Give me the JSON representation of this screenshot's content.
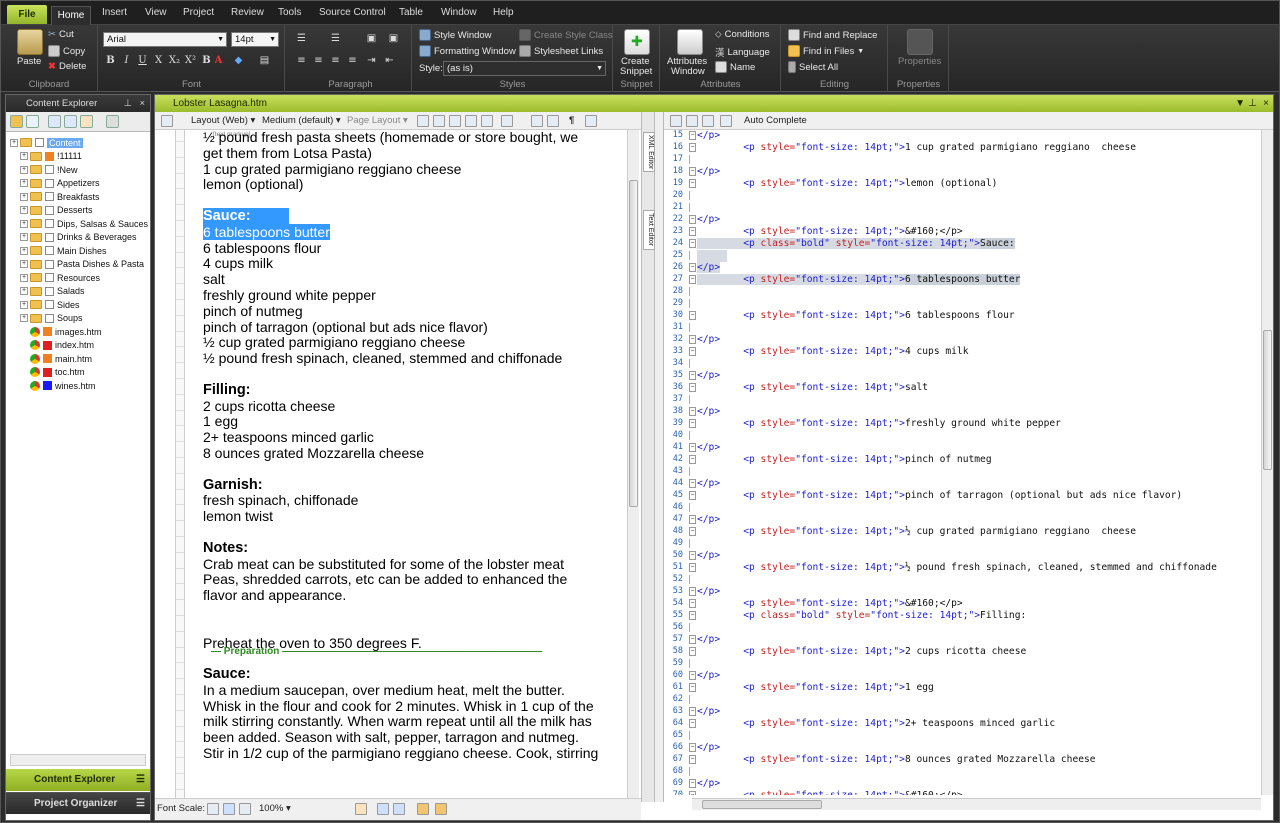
{
  "ribbon": {
    "tabs": [
      "File",
      "Home",
      "Insert",
      "View",
      "Project",
      "Review",
      "Tools",
      "Source Control",
      "Table",
      "Window",
      "Help"
    ],
    "clipboard": {
      "paste": "Paste",
      "cut": "Cut",
      "copy": "Copy",
      "delete": "Delete",
      "label": "Clipboard"
    },
    "font": {
      "family": "Arial",
      "size": "14pt",
      "label": "Font"
    },
    "paragraph": {
      "label": "Paragraph"
    },
    "styles": {
      "style_window": "Style Window",
      "formatting_window": "Formatting Window",
      "create_style_class": "Create Style Class",
      "stylesheet_links": "Stylesheet Links",
      "style_label": "Style:",
      "style_value": "(as is)",
      "label": "Styles"
    },
    "snippet": {
      "create": "Create",
      "snippet": "Snippet",
      "label": "Snippet"
    },
    "attributes": {
      "attributes": "Attributes",
      "window": "Window",
      "conditions": "Conditions",
      "language": "Language",
      "name": "Name",
      "label": "Attributes"
    },
    "editing": {
      "find_replace": "Find and Replace",
      "find_in_files": "Find in Files",
      "select_all": "Select All",
      "label": "Editing"
    },
    "properties": {
      "btn": "Properties",
      "label": "Properties"
    }
  },
  "left_pane": {
    "title": "Content Explorer",
    "tree": [
      {
        "name": "Content",
        "type": "root"
      },
      {
        "name": "!11111",
        "type": "folder",
        "color": "#f08020"
      },
      {
        "name": "!New",
        "type": "folder"
      },
      {
        "name": "Appetizers",
        "type": "folder"
      },
      {
        "name": "Breakfasts",
        "type": "folder"
      },
      {
        "name": "Desserts",
        "type": "folder"
      },
      {
        "name": "Dips, Salsas & Sauces",
        "type": "folder"
      },
      {
        "name": "Drinks & Beverages",
        "type": "folder"
      },
      {
        "name": "Main Dishes",
        "type": "folder"
      },
      {
        "name": "Pasta Dishes & Pasta",
        "type": "folder"
      },
      {
        "name": "Resources",
        "type": "folder"
      },
      {
        "name": "Salads",
        "type": "folder"
      },
      {
        "name": "Sides",
        "type": "folder"
      },
      {
        "name": "Soups",
        "type": "folder"
      },
      {
        "name": "images.htm",
        "type": "file",
        "color": "#f08020"
      },
      {
        "name": "index.htm",
        "type": "file",
        "color": "#e02020"
      },
      {
        "name": "main.htm",
        "type": "file",
        "color": "#f08020"
      },
      {
        "name": "toc.htm",
        "type": "file",
        "color": "#e02020"
      },
      {
        "name": "wines.htm",
        "type": "file",
        "color": "#1a1aff"
      }
    ],
    "accordion": [
      "Content Explorer",
      "Project Organizer"
    ]
  },
  "editor": {
    "title": "Lobster Lasagna.htm",
    "toolbar": {
      "layout": "Layout (Web)",
      "medium": "Medium (default)",
      "page_layout": "Page Layout",
      "text_markup": "[text markup]"
    },
    "code_toolbar": {
      "auto_complete": "Auto Complete"
    },
    "side_tabs": [
      "XML Editor",
      "Text Editor"
    ],
    "status": {
      "font_scale": "Font Scale:",
      "zoom": "100%"
    },
    "doc_lines": [
      {
        "t": "½ pound fresh pasta sheets (homemade or store bought, we"
      },
      {
        "t": "get them from Lotsa Pasta)"
      },
      {
        "t": "1 cup grated parmigiano reggiano cheese"
      },
      {
        "t": "lemon (optional)"
      },
      {
        "t": ""
      },
      {
        "t": "Sauce:",
        "b": true,
        "sel": true
      },
      {
        "t": "6 tablespoons butter",
        "sel": true
      },
      {
        "t": "6 tablespoons flour"
      },
      {
        "t": "4 cups milk"
      },
      {
        "t": "salt"
      },
      {
        "t": "freshly ground white pepper"
      },
      {
        "t": "pinch of nutmeg"
      },
      {
        "t": "pinch of tarragon (optional but ads nice flavor)"
      },
      {
        "t": "½ cup grated parmigiano reggiano cheese"
      },
      {
        "t": "½ pound fresh spinach, cleaned, stemmed and chiffonade"
      },
      {
        "t": ""
      },
      {
        "t": "Filling:",
        "b": true
      },
      {
        "t": "2 cups ricotta cheese"
      },
      {
        "t": "1 egg"
      },
      {
        "t": "2+ teaspoons minced garlic"
      },
      {
        "t": "8 ounces grated Mozzarella cheese"
      },
      {
        "t": ""
      },
      {
        "t": "Garnish:",
        "b": true
      },
      {
        "t": "fresh spinach, chiffonade"
      },
      {
        "t": "lemon twist"
      },
      {
        "t": ""
      },
      {
        "t": "Notes:",
        "b": true
      },
      {
        "t": "Crab meat can be substituted for some of the lobster meat"
      },
      {
        "t": "Peas, shredded carrots, etc can be added to enhanced the"
      },
      {
        "t": "flavor and appearance."
      },
      {
        "t": ""
      },
      {
        "t": ""
      },
      {
        "t": "Preheat the oven to 350 degrees F."
      },
      {
        "t": ""
      },
      {
        "t": "Sauce:",
        "b": true
      },
      {
        "t": "In a medium saucepan, over medium heat, melt the butter."
      },
      {
        "t": "Whisk in the flour and cook for 2 minutes. Whisk in 1 cup of the"
      },
      {
        "t": "milk stirring constantly. When warm repeat until all the milk has"
      },
      {
        "t": "been added. Season with salt, pepper, tarragon and nutmeg."
      },
      {
        "t": "Stir in 1/2 cup of the parmigiano reggiano cheese. Cook, stirring"
      }
    ],
    "preparation_label": "Preparation",
    "code_lines": [
      {
        "n": "15",
        "k": "close"
      },
      {
        "n": "16",
        "k": "p",
        "txt": "1 cup grated parmigiano reggiano  cheese"
      },
      {
        "n": "17",
        "k": "blank"
      },
      {
        "n": "18",
        "k": "close"
      },
      {
        "n": "19",
        "k": "p",
        "txt": "lemon (optional)"
      },
      {
        "n": "20",
        "k": "blank"
      },
      {
        "n": "21",
        "k": "blank"
      },
      {
        "n": "22",
        "k": "close"
      },
      {
        "n": "23",
        "k": "p",
        "txt": "&#160;</p>"
      },
      {
        "n": "24",
        "k": "pbold",
        "txt": "Sauce:",
        "hl": true
      },
      {
        "n": "25",
        "k": "blank",
        "hl": true
      },
      {
        "n": "26",
        "k": "close",
        "hl": true
      },
      {
        "n": "27",
        "k": "p",
        "txt": "6 tablespoons butter",
        "hl": true
      },
      {
        "n": "28",
        "k": "blank"
      },
      {
        "n": "29",
        "k": "blank"
      },
      {
        "n": "30",
        "k": "p",
        "txt": "6 tablespoons flour"
      },
      {
        "n": "31",
        "k": "blank"
      },
      {
        "n": "32",
        "k": "close"
      },
      {
        "n": "33",
        "k": "p",
        "txt": "4 cups milk"
      },
      {
        "n": "34",
        "k": "blank"
      },
      {
        "n": "35",
        "k": "close"
      },
      {
        "n": "36",
        "k": "p",
        "txt": "salt"
      },
      {
        "n": "37",
        "k": "blank"
      },
      {
        "n": "38",
        "k": "close"
      },
      {
        "n": "39",
        "k": "p",
        "txt": "freshly ground white pepper"
      },
      {
        "n": "40",
        "k": "blank"
      },
      {
        "n": "41",
        "k": "close"
      },
      {
        "n": "42",
        "k": "p",
        "txt": "pinch of nutmeg"
      },
      {
        "n": "43",
        "k": "blank"
      },
      {
        "n": "44",
        "k": "close"
      },
      {
        "n": "45",
        "k": "p",
        "txt": "pinch of tarragon (optional but ads nice flavor)"
      },
      {
        "n": "46",
        "k": "blank"
      },
      {
        "n": "47",
        "k": "close"
      },
      {
        "n": "48",
        "k": "p",
        "txt": "½ cup grated parmigiano reggiano  cheese"
      },
      {
        "n": "49",
        "k": "blank"
      },
      {
        "n": "50",
        "k": "close"
      },
      {
        "n": "51",
        "k": "p",
        "txt": "½ pound fresh spinach, cleaned, stemmed and chiffonade"
      },
      {
        "n": "52",
        "k": "blank"
      },
      {
        "n": "53",
        "k": "close"
      },
      {
        "n": "54",
        "k": "p",
        "txt": "&#160;</p>"
      },
      {
        "n": "55",
        "k": "pbold",
        "txt": "Filling:"
      },
      {
        "n": "56",
        "k": "blank"
      },
      {
        "n": "57",
        "k": "close"
      },
      {
        "n": "58",
        "k": "p",
        "txt": "2 cups ricotta cheese"
      },
      {
        "n": "59",
        "k": "blank"
      },
      {
        "n": "60",
        "k": "close"
      },
      {
        "n": "61",
        "k": "p",
        "txt": "1 egg"
      },
      {
        "n": "62",
        "k": "blank"
      },
      {
        "n": "63",
        "k": "close"
      },
      {
        "n": "64",
        "k": "p",
        "txt": "2+ teaspoons minced garlic"
      },
      {
        "n": "65",
        "k": "blank"
      },
      {
        "n": "66",
        "k": "close"
      },
      {
        "n": "67",
        "k": "p",
        "txt": "8 ounces grated Mozzarella cheese"
      },
      {
        "n": "68",
        "k": "blank"
      },
      {
        "n": "69",
        "k": "close"
      },
      {
        "n": "70",
        "k": "p",
        "txt": "&#160;</p>"
      }
    ],
    "code_strings": {
      "close": "</p>",
      "p_open": "<p",
      "style_attr": "style=",
      "class_attr": "class=",
      "bold_val": "\"bold\"",
      "style_val": "\"font-size: 14pt;\"",
      "gt": ">"
    }
  },
  "colors": {
    "accent": "#9cbb2c",
    "selection": "#3399ff",
    "code_tag": "#2020d0",
    "code_attr": "#c81e1e"
  }
}
